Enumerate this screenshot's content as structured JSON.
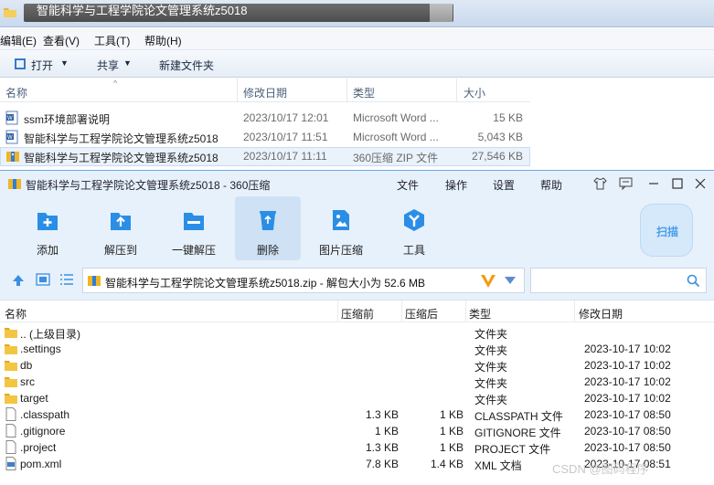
{
  "explorer": {
    "title": "智能科学与工程学院论文管理系统z5018",
    "menu": [
      "编辑(E)",
      "查看(V)",
      "工具(T)",
      "帮助(H)"
    ],
    "toolbar": {
      "open": "打开",
      "share": "共享",
      "new_folder": "新建文件夹"
    },
    "columns": {
      "name": "名称",
      "modified": "修改日期",
      "type": "类型",
      "size": "大小"
    },
    "files": [
      {
        "name": "ssm环境部署说明",
        "modified": "2023/10/17 12:01",
        "type": "Microsoft Word ...",
        "size": "15 KB"
      },
      {
        "name": "智能科学与工程学院论文管理系统z5018",
        "modified": "2023/10/17 11:51",
        "type": "Microsoft Word ...",
        "size": "5,043 KB"
      },
      {
        "name": "智能科学与工程学院论文管理系统z5018",
        "modified": "2023/10/17 11:11",
        "type": "360压缩 ZIP 文件",
        "size": "27,546 KB"
      }
    ]
  },
  "zip": {
    "title": "智能科学与工程学院论文管理系统z5018 - 360压缩",
    "menu": [
      "文件",
      "操作",
      "设置",
      "帮助"
    ],
    "ribbon": [
      "添加",
      "解压到",
      "一键解压",
      "删除",
      "图片压缩",
      "工具"
    ],
    "scan": "扫描",
    "address": "智能科学与工程学院论文管理系统z5018.zip - 解包大小为 52.6 MB",
    "columns": {
      "name": "名称",
      "before": "压缩前",
      "after": "压缩后",
      "type": "类型",
      "modified": "修改日期"
    },
    "rows": [
      {
        "name": ".. (上级目录)",
        "before": "",
        "after": "",
        "type": "文件夹",
        "modified": "",
        "icon": "folder"
      },
      {
        "name": ".settings",
        "before": "",
        "after": "",
        "type": "文件夹",
        "modified": "2023-10-17 10:02",
        "icon": "folder"
      },
      {
        "name": "db",
        "before": "",
        "after": "",
        "type": "文件夹",
        "modified": "2023-10-17 10:02",
        "icon": "folder"
      },
      {
        "name": "src",
        "before": "",
        "after": "",
        "type": "文件夹",
        "modified": "2023-10-17 10:02",
        "icon": "folder"
      },
      {
        "name": "target",
        "before": "",
        "after": "",
        "type": "文件夹",
        "modified": "2023-10-17 10:02",
        "icon": "folder"
      },
      {
        "name": ".classpath",
        "before": "1.3 KB",
        "after": "1 KB",
        "type": "CLASSPATH 文件",
        "modified": "2023-10-17 08:50",
        "icon": "file"
      },
      {
        "name": ".gitignore",
        "before": "1 KB",
        "after": "1 KB",
        "type": "GITIGNORE 文件",
        "modified": "2023-10-17 08:50",
        "icon": "file"
      },
      {
        "name": ".project",
        "before": "1.3 KB",
        "after": "1 KB",
        "type": "PROJECT 文件",
        "modified": "2023-10-17 08:50",
        "icon": "file"
      },
      {
        "name": "pom.xml",
        "before": "7.8 KB",
        "after": "1.4 KB",
        "type": "XML 文档",
        "modified": "2023-10-17 08:51",
        "icon": "xml"
      }
    ]
  },
  "watermark": "CSDN @图码程序"
}
